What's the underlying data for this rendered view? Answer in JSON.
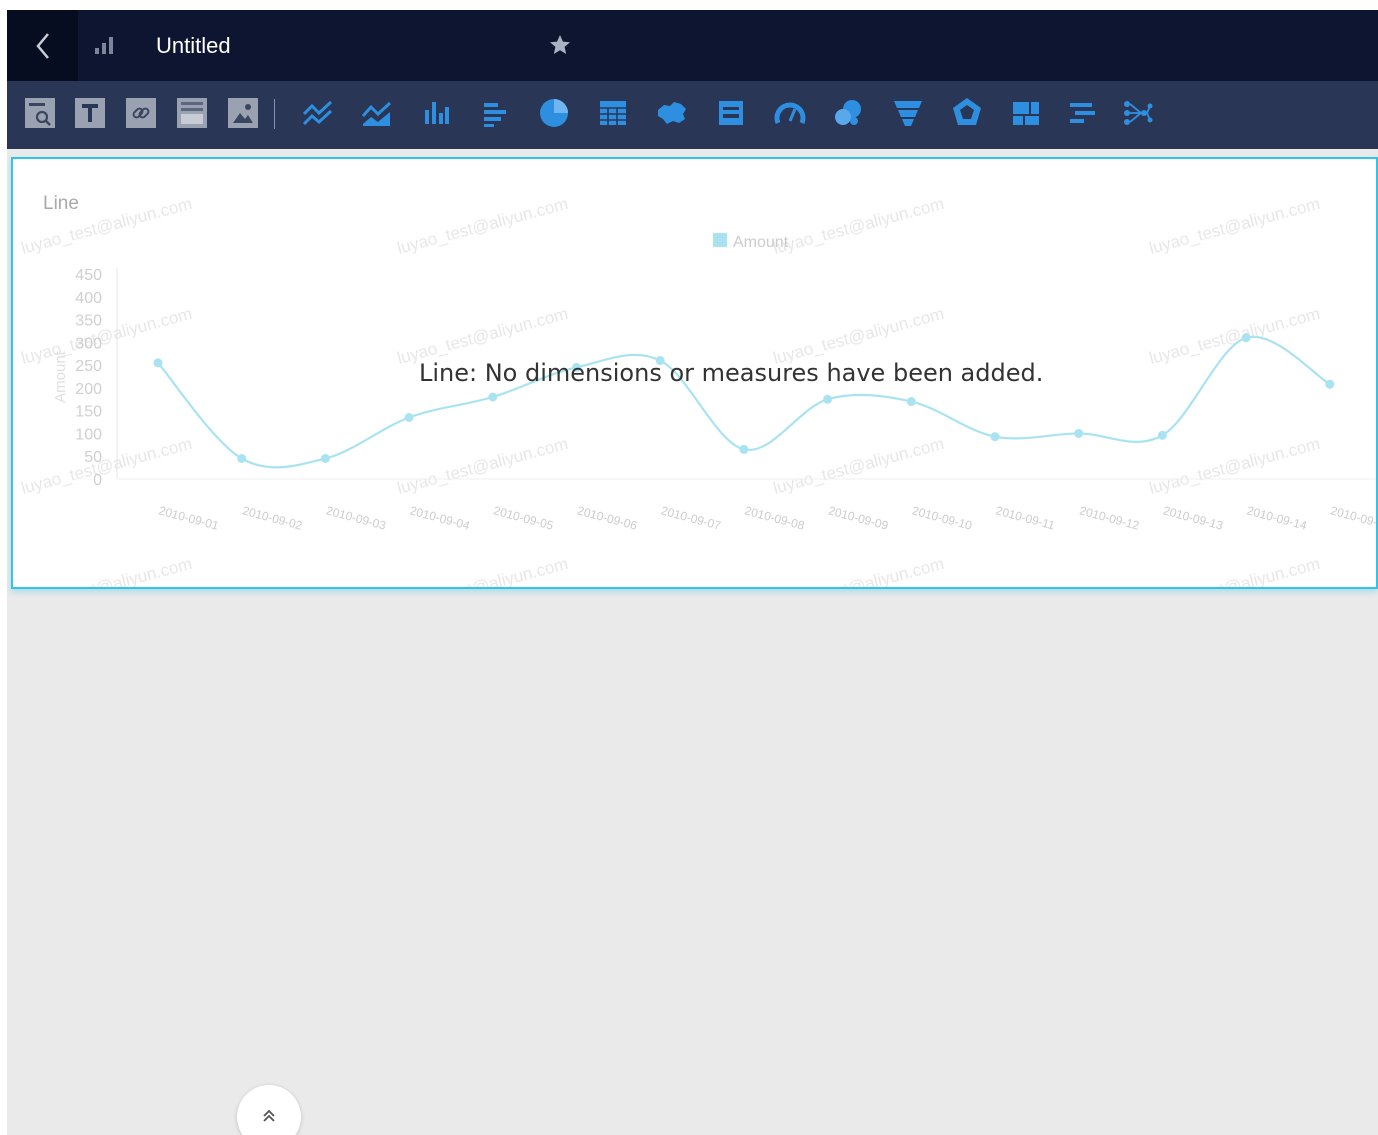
{
  "header": {
    "title": "Untitled"
  },
  "toolbar": {
    "tools": [
      {
        "name": "query-control-icon"
      },
      {
        "name": "text-icon"
      },
      {
        "name": "link-icon"
      },
      {
        "name": "iframe-icon"
      },
      {
        "name": "image-icon"
      },
      {
        "name": "line-chart-icon"
      },
      {
        "name": "area-chart-icon"
      },
      {
        "name": "column-chart-icon"
      },
      {
        "name": "bar-chart-icon"
      },
      {
        "name": "pie-chart-icon"
      },
      {
        "name": "table-icon"
      },
      {
        "name": "map-icon"
      },
      {
        "name": "kpi-card-icon"
      },
      {
        "name": "gauge-icon"
      },
      {
        "name": "bubble-icon"
      },
      {
        "name": "funnel-icon"
      },
      {
        "name": "radar-icon"
      },
      {
        "name": "treemap-icon"
      },
      {
        "name": "gantt-icon"
      },
      {
        "name": "relationship-icon"
      }
    ]
  },
  "card": {
    "title": "Line",
    "empty_message": "Line: No dimensions or measures have been added.",
    "watermark": "luyao_test@aliyun.com"
  },
  "colors": {
    "header_bg": "#0d1530",
    "toolbar_bg": "#2a3655",
    "accent": "#33c2e8",
    "tool_blue": "#2e8fe0",
    "canvas_bg": "#eaeaea"
  },
  "chart_data": {
    "type": "line",
    "legend": [
      "Amount"
    ],
    "ylabel": "Amount",
    "ylim": [
      0,
      450
    ],
    "yticks": [
      "450",
      "400",
      "350",
      "300",
      "250",
      "200",
      "150",
      "100",
      "50",
      "0"
    ],
    "categories": [
      "2010-09-01",
      "2010-09-02",
      "2010-09-03",
      "2010-09-04",
      "2010-09-05",
      "2010-09-06",
      "2010-09-07",
      "2010-09-08",
      "2010-09-09",
      "2010-09-10",
      "2010-09-11",
      "2010-09-12",
      "2010-09-13",
      "2010-09-14",
      "2010-09-"
    ],
    "series": [
      {
        "name": "Amount",
        "values": [
          255,
          45,
          45,
          135,
          180,
          245,
          260,
          65,
          175,
          170,
          93,
          100,
          96,
          310,
          208
        ]
      }
    ]
  }
}
